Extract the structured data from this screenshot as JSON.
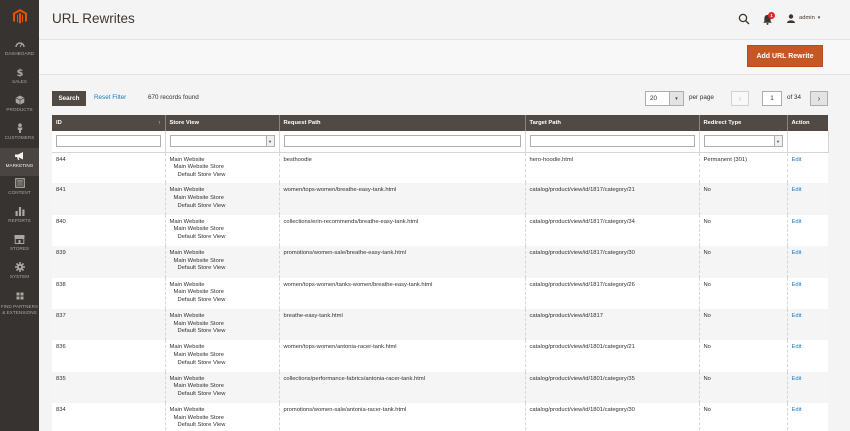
{
  "page": {
    "title": "URL Rewrites"
  },
  "header": {
    "notification_count": "1",
    "user_name": "admin"
  },
  "sidebar": {
    "items": [
      {
        "label": "DASHBOARD",
        "icon": "dashboard-icon"
      },
      {
        "label": "SALES",
        "icon": "dollar-icon"
      },
      {
        "label": "PRODUCTS",
        "icon": "cube-icon"
      },
      {
        "label": "CUSTOMERS",
        "icon": "person-icon"
      },
      {
        "label": "MARKETING",
        "icon": "megaphone-icon",
        "active": true
      },
      {
        "label": "CONTENT",
        "icon": "content-icon"
      },
      {
        "label": "REPORTS",
        "icon": "bar-chart-icon"
      },
      {
        "label": "STORES",
        "icon": "store-icon"
      },
      {
        "label": "SYSTEM",
        "icon": "gear-icon"
      },
      {
        "label": "FIND PARTNERS & EXTENSIONS",
        "icon": "partners-icon"
      }
    ]
  },
  "actions": {
    "add_label": "Add URL Rewrite"
  },
  "toolbar": {
    "search_label": "Search",
    "reset_label": "Reset Filter",
    "records": "670 records found",
    "per_page_value": "20",
    "per_page_label": "per page",
    "page_current": "1",
    "page_of": "of 34"
  },
  "grid": {
    "columns": [
      "ID",
      "Store View",
      "Request Path",
      "Target Path",
      "Redirect Type",
      "Action"
    ],
    "rows": [
      {
        "id": "844",
        "website": "Main Website",
        "store": "Main Website Store",
        "view": "Default Store View",
        "request": "besthoodie",
        "target": "hero-hoodie.html",
        "redirect": "Permanent (301)",
        "action": "Edit"
      },
      {
        "id": "841",
        "website": "Main Website",
        "store": "Main Website Store",
        "view": "Default Store View",
        "request": "women/tops-women/breathe-easy-tank.html",
        "target": "catalog/product/view/id/1817/category/21",
        "redirect": "No",
        "action": "Edit"
      },
      {
        "id": "840",
        "website": "Main Website",
        "store": "Main Website Store",
        "view": "Default Store View",
        "request": "collections/erin-recommends/breathe-easy-tank.html",
        "target": "catalog/product/view/id/1817/category/34",
        "redirect": "No",
        "action": "Edit"
      },
      {
        "id": "839",
        "website": "Main Website",
        "store": "Main Website Store",
        "view": "Default Store View",
        "request": "promotions/women-sale/breathe-easy-tank.html",
        "target": "catalog/product/view/id/1817/category/30",
        "redirect": "No",
        "action": "Edit"
      },
      {
        "id": "838",
        "website": "Main Website",
        "store": "Main Website Store",
        "view": "Default Store View",
        "request": "women/tops-women/tanks-women/breathe-easy-tank.html",
        "target": "catalog/product/view/id/1817/category/26",
        "redirect": "No",
        "action": "Edit"
      },
      {
        "id": "837",
        "website": "Main Website",
        "store": "Main Website Store",
        "view": "Default Store View",
        "request": "breathe-easy-tank.html",
        "target": "catalog/product/view/id/1817",
        "redirect": "No",
        "action": "Edit"
      },
      {
        "id": "836",
        "website": "Main Website",
        "store": "Main Website Store",
        "view": "Default Store View",
        "request": "women/tops-women/antonia-racer-tank.html",
        "target": "catalog/product/view/id/1801/category/21",
        "redirect": "No",
        "action": "Edit"
      },
      {
        "id": "835",
        "website": "Main Website",
        "store": "Main Website Store",
        "view": "Default Store View",
        "request": "collections/performance-fabrics/antonia-racer-tank.html",
        "target": "catalog/product/view/id/1801/category/35",
        "redirect": "No",
        "action": "Edit"
      },
      {
        "id": "834",
        "website": "Main Website",
        "store": "Main Website Store",
        "view": "Default Store View",
        "request": "promotions/women-sale/antonia-racer-tank.html",
        "target": "catalog/product/view/id/1801/category/30",
        "redirect": "No",
        "action": "Edit"
      }
    ]
  },
  "colors": {
    "accent": "#c65725",
    "sidebar_bg": "#373330",
    "header_bg": "#514943",
    "link": "#1979c3"
  }
}
